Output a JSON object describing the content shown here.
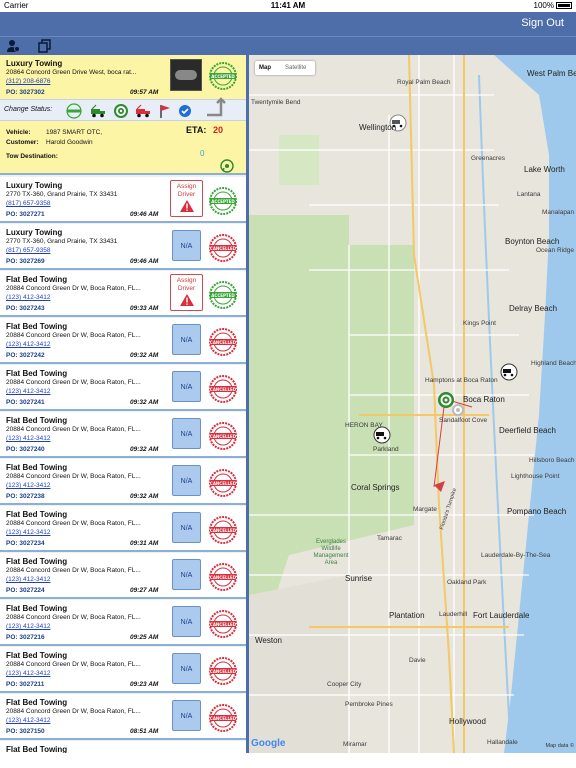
{
  "status_bar": {
    "carrier": "Carrier",
    "time": "11:41 AM",
    "battery": "100%"
  },
  "nav": {
    "sign_out": "Sign Out"
  },
  "selected": {
    "title": "Luxury Towing",
    "address": "20864 Concord Green Drive West, boca rat...",
    "phone": "(312) 208-6876",
    "po": "PO: 3027302",
    "time": "09:57 AM",
    "change_status_label": "Change Status:",
    "vehicle_label": "Vehicle:",
    "vehicle_value": "1987 SMART OTC,",
    "customer_label": "Customer:",
    "customer_value": "Harold Goodwin",
    "tow_dest_label": "Tow Destination:",
    "eta_label": "ETA:",
    "eta_value": "20",
    "zero_value": "0",
    "stamp": "ACCEPTED"
  },
  "jobs": [
    {
      "title": "Luxury Towing",
      "address": "2770 TX-360, Grand Prairie, TX 33431",
      "phone": "(817) 657-9358",
      "po": "PO: 3027271",
      "time": "09:46 AM",
      "action": "assign",
      "action_label_1": "Assign",
      "action_label_2": "Driver",
      "stamp": "ACCEPTED"
    },
    {
      "title": "Luxury Towing",
      "address": "2770 TX-360, Grand Prairie, TX 33431",
      "phone": "(817) 657-9358",
      "po": "PO: 3027269",
      "time": "09:46 AM",
      "action": "na",
      "action_label_1": "N/A",
      "action_label_2": "",
      "stamp": "CANCELLED"
    },
    {
      "title": "Flat Bed Towing",
      "address": "20884 Concord Green Dr W, Boca Raton, FL...",
      "phone": "(123) 412-3412",
      "po": "PO: 3027243",
      "time": "09:33 AM",
      "action": "assign",
      "action_label_1": "Assign",
      "action_label_2": "Driver",
      "stamp": "ACCEPTED"
    },
    {
      "title": "Flat Bed Towing",
      "address": "20884 Concord Green Dr W, Boca Raton, FL...",
      "phone": "(123) 412-3412",
      "po": "PO: 3027242",
      "time": "09:32 AM",
      "action": "na",
      "action_label_1": "N/A",
      "action_label_2": "",
      "stamp": "CANCELLED"
    },
    {
      "title": "Flat Bed Towing",
      "address": "20884 Concord Green Dr W, Boca Raton, FL...",
      "phone": "(123) 412-3412",
      "po": "PO: 3027241",
      "time": "09:32 AM",
      "action": "na",
      "action_label_1": "N/A",
      "action_label_2": "",
      "stamp": "CANCELLED"
    },
    {
      "title": "Flat Bed Towing",
      "address": "20884 Concord Green Dr W, Boca Raton, FL...",
      "phone": "(123) 412-3412",
      "po": "PO: 3027240",
      "time": "09:32 AM",
      "action": "na",
      "action_label_1": "N/A",
      "action_label_2": "",
      "stamp": "CANCELLED"
    },
    {
      "title": "Flat Bed Towing",
      "address": "20884 Concord Green Dr W, Boca Raton, FL...",
      "phone": "(123) 412-3412",
      "po": "PO: 3027238",
      "time": "09:32 AM",
      "action": "na",
      "action_label_1": "N/A",
      "action_label_2": "",
      "stamp": "CANCELLED"
    },
    {
      "title": "Flat Bed Towing",
      "address": "20884 Concord Green Dr W, Boca Raton, FL...",
      "phone": "(123) 412-3412",
      "po": "PO: 3027234",
      "time": "09:31 AM",
      "action": "na",
      "action_label_1": "N/A",
      "action_label_2": "",
      "stamp": "CANCELLED"
    },
    {
      "title": "Flat Bed Towing",
      "address": "20884 Concord Green Dr W, Boca Raton, FL...",
      "phone": "(123) 412-3412",
      "po": "PO: 3027224",
      "time": "09:27 AM",
      "action": "na",
      "action_label_1": "N/A",
      "action_label_2": "",
      "stamp": "CANCELLED"
    },
    {
      "title": "Flat Bed Towing",
      "address": "20884 Concord Green Dr W, Boca Raton, FL...",
      "phone": "(123) 412-3412",
      "po": "PO: 3027216",
      "time": "09:25 AM",
      "action": "na",
      "action_label_1": "N/A",
      "action_label_2": "",
      "stamp": "CANCELLED"
    },
    {
      "title": "Flat Bed Towing",
      "address": "20884 Concord Green Dr W, Boca Raton, FL...",
      "phone": "(123) 412-3412",
      "po": "PO: 3027211",
      "time": "09:23 AM",
      "action": "na",
      "action_label_1": "N/A",
      "action_label_2": "",
      "stamp": "CANCELLED"
    },
    {
      "title": "Flat Bed Towing",
      "address": "20884 Concord Green Dr W, Boca Raton, FL...",
      "phone": "(123) 412-3412",
      "po": "PO: 3027150",
      "time": "08:51 AM",
      "action": "na",
      "action_label_1": "N/A",
      "action_label_2": "",
      "stamp": "CANCELLED"
    },
    {
      "title": "Flat Bed Towing",
      "address": "",
      "phone": "",
      "po": "",
      "time": "",
      "action": "none",
      "action_label_1": "",
      "action_label_2": "",
      "stamp": ""
    }
  ],
  "map": {
    "tab_map": "Map",
    "tab_satellite": "Satellite",
    "google": "Google",
    "copyright": "Map data ©",
    "labels": [
      {
        "text": "Royal Palm Beach",
        "cls": "lbl"
      },
      {
        "text": "West Palm Beach",
        "cls": "city"
      },
      {
        "text": "Twentymile Bend",
        "cls": "lbl"
      },
      {
        "text": "Wellington",
        "cls": "city"
      },
      {
        "text": "Lake Worth",
        "cls": "city"
      },
      {
        "text": "Greenacres",
        "cls": "lbl"
      },
      {
        "text": "Lantana",
        "cls": "lbl"
      },
      {
        "text": "Manalapan",
        "cls": "lbl"
      },
      {
        "text": "Boynton Beach",
        "cls": "city"
      },
      {
        "text": "Ocean Ridge",
        "cls": "lbl"
      },
      {
        "text": "Delray Beach",
        "cls": "city"
      },
      {
        "text": "Kings Point",
        "cls": "lbl"
      },
      {
        "text": "Highland Beach",
        "cls": "lbl"
      },
      {
        "text": "Hamptons at Boca Raton",
        "cls": "lbl"
      },
      {
        "text": "Boca Raton",
        "cls": "city"
      },
      {
        "text": "Sandalfoot Cove",
        "cls": "lbl"
      },
      {
        "text": "Parkland",
        "cls": "lbl"
      },
      {
        "text": "HERON BAY",
        "cls": "lbl"
      },
      {
        "text": "Deerfield Beach",
        "cls": "city"
      },
      {
        "text": "Hillsboro Beach",
        "cls": "lbl"
      },
      {
        "text": "Coral Springs",
        "cls": "city"
      },
      {
        "text": "Lighthouse Point",
        "cls": "lbl"
      },
      {
        "text": "Margate",
        "cls": "lbl"
      },
      {
        "text": "Pompano Beach",
        "cls": "city"
      },
      {
        "text": "Tamarac",
        "cls": "lbl"
      },
      {
        "text": "Everglades Wildlife Management Area",
        "cls": "park"
      },
      {
        "text": "Lauderdale-By-The-Sea",
        "cls": "lbl"
      },
      {
        "text": "Sunrise",
        "cls": "city"
      },
      {
        "text": "Oakland Park",
        "cls": "lbl"
      },
      {
        "text": "Lauderhill",
        "cls": "lbl"
      },
      {
        "text": "Plantation",
        "cls": "city"
      },
      {
        "text": "Fort Lauderdale",
        "cls": "city"
      },
      {
        "text": "Weston",
        "cls": "city"
      },
      {
        "text": "Davie",
        "cls": "lbl"
      },
      {
        "text": "Cooper City",
        "cls": "lbl"
      },
      {
        "text": "Pembroke Pines",
        "cls": "lbl"
      },
      {
        "text": "Miramar",
        "cls": "lbl"
      },
      {
        "text": "Hollywood",
        "cls": "city"
      },
      {
        "text": "Hallandale",
        "cls": "lbl"
      },
      {
        "text": "Florida's Turnpike",
        "cls": "lbl"
      }
    ]
  },
  "colors": {
    "nav": "#4d6ea8",
    "selected_bg": "#fdf5a6",
    "divider": "#8ab0d8",
    "accepted": "#3aa537",
    "cancelled": "#d92f3d",
    "na_bg": "#acc9ee"
  }
}
